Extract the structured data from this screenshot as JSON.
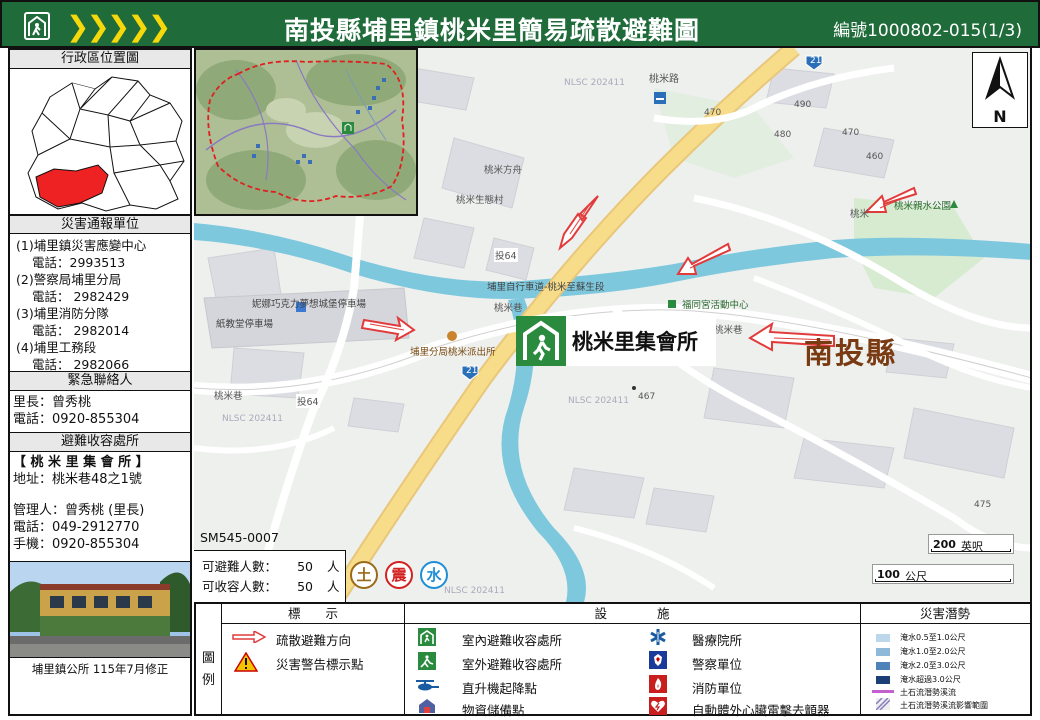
{
  "header": {
    "chevrons": "❯❯❯❯❯",
    "title": "南投縣埔里鎮桃米里簡易疏散避難圖",
    "code": "編號1000802-015(1/3)"
  },
  "sidebar": {
    "location_header": "行政區位置圖",
    "report_header": "災害通報單位",
    "report_units": [
      {
        "name": "(1)埔里鎮災害應變中心",
        "phone": "電話：2993513"
      },
      {
        "name": "(2)警察局埔里分局",
        "phone": "電話： 2982429"
      },
      {
        "name": "(3)埔里消防分隊",
        "phone": "電話： 2982014"
      },
      {
        "name": "(4)埔里工務段",
        "phone": "電話： 2982066"
      }
    ],
    "contact_header": "緊急聯絡人",
    "contact": [
      "里長：曾秀桃",
      "電話：0920-855304"
    ],
    "shelter_header": "避難收容處所",
    "shelter": {
      "name": "【 桃 米 里 集 會 所 】",
      "address": "地址：桃米巷48之1號",
      "manager": "管理人：曾秀桃 (里長)",
      "phone": "電話：049-2912770",
      "mobile": "手機：0920-855304"
    },
    "footer": "埔里鎮公所 115年7月修正"
  },
  "map": {
    "sheet_code": "SM545-0007",
    "capacity": [
      {
        "label": "可避難人數：",
        "value": "50",
        "unit": "人"
      },
      {
        "label": "可收容人數：",
        "value": "50",
        "unit": "人"
      }
    ],
    "hazard_badges": [
      "土",
      "震",
      "水"
    ],
    "shelter_label": "桃米里集會所",
    "county_label": "南投縣",
    "north": "N",
    "scale": [
      {
        "value": "200",
        "unit": "英呎"
      },
      {
        "value": "100",
        "unit": "公尺"
      }
    ],
    "labels": {
      "taomi_road": "桃米路",
      "route21_top": "21",
      "route21_mid": "21",
      "taomi_fangzhou": "桃米方舟",
      "taomi_sheng": "桃米生態村",
      "bikeway": "埔里自行車道-桃米至蘇生段",
      "choco": "妮娜巧克力夢想城堡停車場",
      "parking": "紙教堂停車場",
      "police": "埔里分局桃米派出所",
      "fufan": "福同宮活動中心",
      "taomi_lane_r": "桃米巷",
      "taomi_lane_b": "桃米巷",
      "taomi_lane_l": "桃米巷",
      "park": "桃米親水公園",
      "taomi_lane_top": "桃米",
      "h64_a": "投64",
      "h64_b": "投64",
      "elev470a": "470",
      "elev470b": "470",
      "elev460": "460",
      "elev475": "475",
      "elev490": "490",
      "elev480": "480",
      "elev467": "467",
      "nlsc1": "NLSC 202411",
      "nlsc2": "NLSC 202411",
      "nlsc3": "NLSC 202411",
      "nlsc4": "NLSC 202411"
    }
  },
  "legend": {
    "side_label": [
      "圖",
      "例"
    ],
    "headers": {
      "symbols": "標　　示",
      "facilities": "設　　　　施",
      "hazard": "災害潛勢"
    },
    "symbols": [
      "疏散避難方向",
      "災害警告標示點"
    ],
    "facilities_col1": [
      "室內避難收容處所",
      "室外避難收容處所",
      "直升機起降點",
      "物資儲備點"
    ],
    "facilities_col2": [
      "醫療院所",
      "警察單位",
      "消防單位",
      "自動體外心臟電擊去顫器"
    ],
    "hazard_items": [
      "淹水0.5至1.0公尺",
      "淹水1.0至2.0公尺",
      "淹水2.0至3.0公尺",
      "淹水超過3.0公尺",
      "土石流潛勢溪流",
      "土石流潛勢溪流影響範圍"
    ]
  },
  "colors": {
    "header_green": "#1f6b3a",
    "river": "#7ec8de",
    "road": "#f7dc8a",
    "shelter_green": "#2a8a3e",
    "arrow_red": "#e23b3b",
    "county_brown": "#7a3a12",
    "flood_1": "#bcd7ea",
    "flood_2": "#8fb9d9",
    "flood_3": "#4f82b8",
    "flood_4": "#1c3f78",
    "debris": "#c45fd0"
  }
}
